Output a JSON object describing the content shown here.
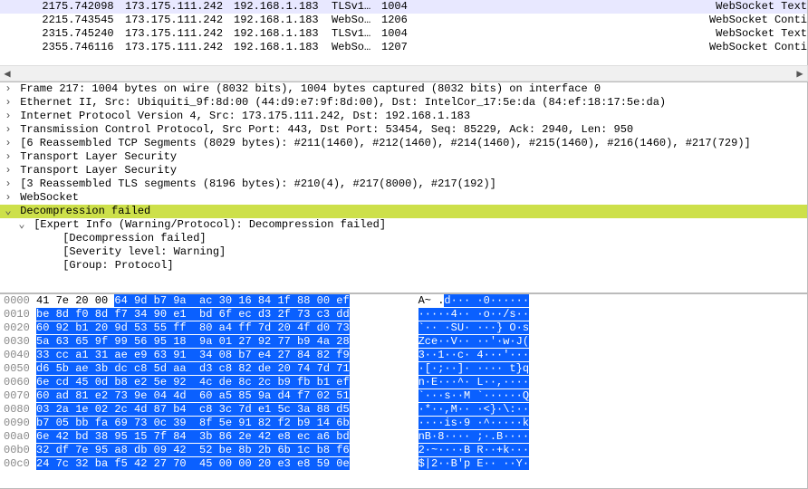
{
  "packet_list": {
    "rows": [
      {
        "no": "217",
        "time": "5.742098",
        "src": "173.175.111.242",
        "dst": "192.168.1.183",
        "proto": "TLSv1…",
        "len": "1004",
        "info": "WebSocket Text"
      },
      {
        "no": "221",
        "time": "5.743545",
        "src": "173.175.111.242",
        "dst": "192.168.1.183",
        "proto": "WebSo…",
        "len": "1206",
        "info": "WebSocket Conti"
      },
      {
        "no": "231",
        "time": "5.745240",
        "src": "173.175.111.242",
        "dst": "192.168.1.183",
        "proto": "TLSv1…",
        "len": "1004",
        "info": "WebSocket Text"
      },
      {
        "no": "235",
        "time": "5.746116",
        "src": "173.175.111.242",
        "dst": "192.168.1.183",
        "proto": "WebSo…",
        "len": "1207",
        "info": "WebSocket Conti"
      }
    ],
    "selected_index": 0
  },
  "detail": {
    "lines": [
      {
        "level": 1,
        "caret": ">",
        "text": "Frame 217: 1004 bytes on wire (8032 bits), 1004 bytes captured (8032 bits) on interface 0"
      },
      {
        "level": 1,
        "caret": ">",
        "text": "Ethernet II, Src: Ubiquiti_9f:8d:00 (44:d9:e7:9f:8d:00), Dst: IntelCor_17:5e:da (84:ef:18:17:5e:da)"
      },
      {
        "level": 1,
        "caret": ">",
        "text": "Internet Protocol Version 4, Src: 173.175.111.242, Dst: 192.168.1.183"
      },
      {
        "level": 1,
        "caret": ">",
        "text": "Transmission Control Protocol, Src Port: 443, Dst Port: 53454, Seq: 85229, Ack: 2940, Len: 950"
      },
      {
        "level": 1,
        "caret": ">",
        "text": "[6 Reassembled TCP Segments (8029 bytes): #211(1460), #212(1460), #214(1460), #215(1460), #216(1460), #217(729)]"
      },
      {
        "level": 1,
        "caret": ">",
        "text": "Transport Layer Security"
      },
      {
        "level": 1,
        "caret": ">",
        "text": "Transport Layer Security"
      },
      {
        "level": 1,
        "caret": ">",
        "text": "[3 Reassembled TLS segments (8196 bytes): #210(4), #217(8000), #217(192)]"
      },
      {
        "level": 1,
        "caret": ">",
        "text": "WebSocket"
      },
      {
        "level": 1,
        "caret": "v",
        "text": "Decompression failed",
        "cls": "decomp"
      },
      {
        "level": 2,
        "caret": "v",
        "text": "[Expert Info (Warning/Protocol): Decompression failed]"
      },
      {
        "level": 3,
        "caret": "",
        "text": "[Decompression failed]"
      },
      {
        "level": 3,
        "caret": "",
        "text": "[Severity level: Warning]"
      },
      {
        "level": 3,
        "caret": "",
        "text": "[Group: Protocol]"
      }
    ]
  },
  "hex": {
    "rows": [
      {
        "off": "0000",
        "p1": "41 7e 20 00 ",
        "sel": "64 9d b7 9a  ac 30 16 84 1f 88 00 ef",
        "ap1": "A~ .",
        "as": "d··· ·0······"
      },
      {
        "off": "0010",
        "p1": "",
        "sel": "be 8d f0 8d f7 34 90 e1  bd 6f ec d3 2f 73 c3 dd",
        "ap1": "",
        "as": "·····4·· ·o··/s··"
      },
      {
        "off": "0020",
        "p1": "",
        "sel": "60 92 b1 20 9d 53 55 ff  80 a4 ff 7d 20 4f d0 73",
        "ap1": "",
        "as": "`·· ·SU· ···} O·s"
      },
      {
        "off": "0030",
        "p1": "",
        "sel": "5a 63 65 9f 99 56 95 18  9a 01 27 92 77 b9 4a 28",
        "ap1": "",
        "as": "Zce··V·· ··'·w·J("
      },
      {
        "off": "0040",
        "p1": "",
        "sel": "33 cc a1 31 ae e9 63 91  34 08 b7 e4 27 84 82 f9",
        "ap1": "",
        "as": "3··1··c· 4···'···"
      },
      {
        "off": "0050",
        "p1": "",
        "sel": "d6 5b ae 3b dc c8 5d aa  d3 c8 82 de 20 74 7d 71",
        "ap1": "",
        "as": "·[·;··]· ···· t}q"
      },
      {
        "off": "0060",
        "p1": "",
        "sel": "6e cd 45 0d b8 e2 5e 92  4c de 8c 2c b9 fb b1 ef",
        "ap1": "",
        "as": "n·E···^· L··,····"
      },
      {
        "off": "0070",
        "p1": "",
        "sel": "60 ad 81 e2 73 9e 04 4d  60 a5 85 9a d4 f7 02 51",
        "ap1": "",
        "as": "`···s··M `······Q"
      },
      {
        "off": "0080",
        "p1": "",
        "sel": "03 2a 1e 02 2c 4d 87 b4  c8 3c 7d e1 5c 3a 88 d5",
        "ap1": "",
        "as": "·*··,M·· ·<}·\\:··"
      },
      {
        "off": "0090",
        "p1": "",
        "sel": "b7 05 bb fa 69 73 0c 39  8f 5e 91 82 f2 b9 14 6b",
        "ap1": "",
        "as": "····is·9 ·^·····k"
      },
      {
        "off": "00a0",
        "p1": "",
        "sel": "6e 42 bd 38 95 15 7f 84  3b 86 2e 42 e8 ec a6 bd",
        "ap1": "",
        "as": "nB·8···· ;·.B····"
      },
      {
        "off": "00b0",
        "p1": "",
        "sel": "32 df 7e 95 a8 db 09 42  52 be 8b 2b 6b 1c b8 f6",
        "ap1": "",
        "as": "2·~····B R··+k···"
      },
      {
        "off": "00c0",
        "p1": "",
        "sel": "24 7c 32 ba f5 42 27 70  45 00 00 20 e3 e8 59 0e",
        "ap1": "",
        "as": "$|2··B'p E·· ··Y·"
      }
    ]
  }
}
